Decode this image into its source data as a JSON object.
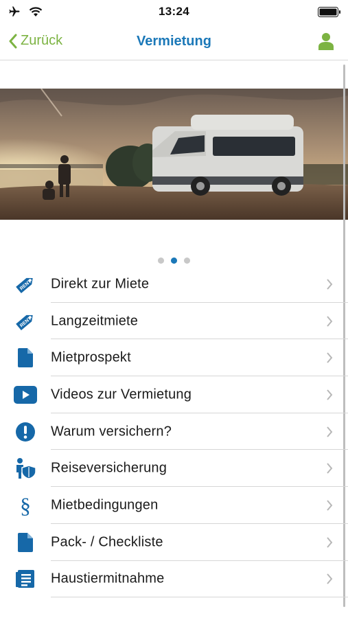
{
  "status": {
    "time": "13:24"
  },
  "nav": {
    "back_label": "Zurück",
    "title": "Vermietung"
  },
  "colors": {
    "accent_blue": "#1b78b8",
    "back_green": "#7cb342",
    "icon_blue": "#1668a8"
  },
  "carousel": {
    "page_count": 3,
    "active_index": 1
  },
  "icons": {
    "status": [
      "airplane-icon",
      "wifi-icon",
      "battery-icon"
    ],
    "nav": [
      "chevron-left-icon",
      "user-icon"
    ],
    "menu": [
      "rent-tag-icon",
      "rent-tag-icon",
      "document-icon",
      "video-play-icon",
      "exclamation-circle-icon",
      "travel-insurance-icon",
      "paragraph-icon",
      "document-icon",
      "list-document-icon"
    ]
  },
  "menu": {
    "items": [
      {
        "label": "Direkt zur Miete"
      },
      {
        "label": "Langzeitmiete"
      },
      {
        "label": "Mietprospekt"
      },
      {
        "label": "Videos zur Vermietung"
      },
      {
        "label": "Warum versichern?"
      },
      {
        "label": "Reiseversicherung"
      },
      {
        "label": "Mietbedingungen"
      },
      {
        "label": "Pack- / Checkliste"
      },
      {
        "label": "Haustiermitnahme"
      }
    ]
  }
}
